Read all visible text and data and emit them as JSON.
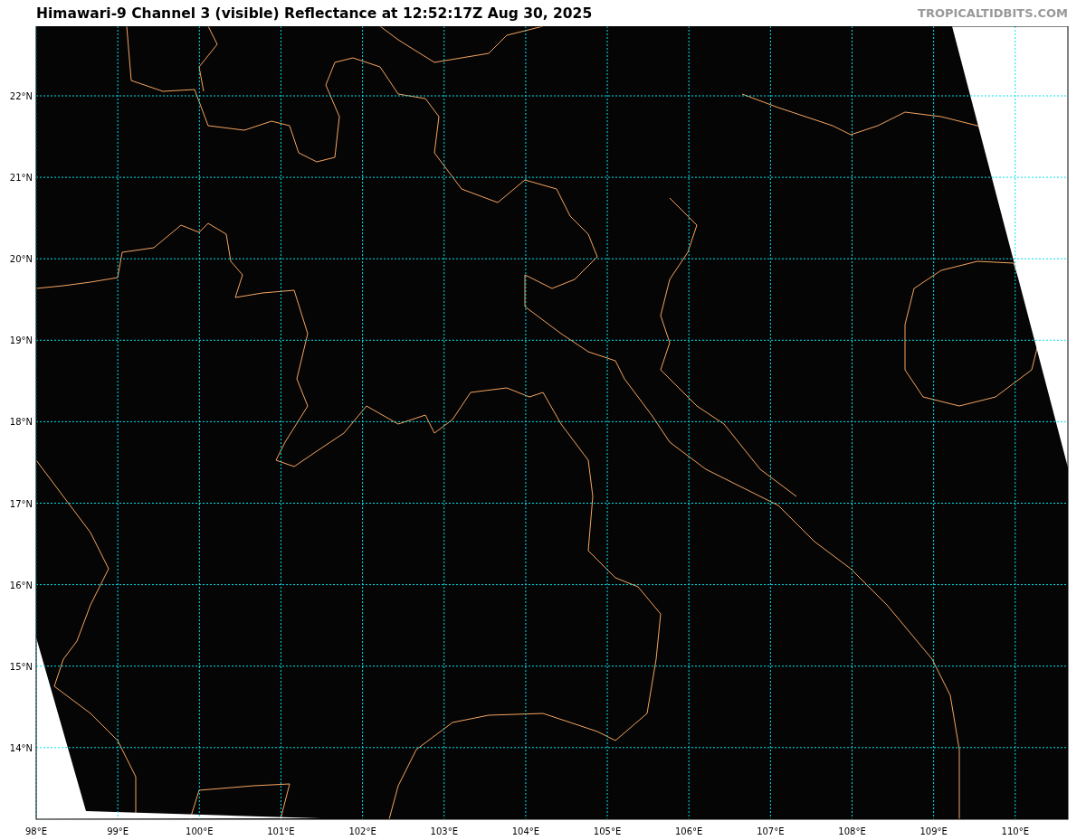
{
  "title": "Himawari-9 Channel 3 (visible) Reflectance at 12:52:17Z Aug 30, 2025",
  "credit": "TROPICALTIDBITS.COM",
  "map": {
    "y_ticks": [
      "22°N",
      "21°N",
      "20°N",
      "19°N",
      "18°N",
      "17°N",
      "16°N",
      "15°N",
      "14°N"
    ],
    "x_ticks": [
      "98°E",
      "99°E",
      "100°E",
      "101°E",
      "102°E",
      "103°E",
      "104°E",
      "105°E",
      "106°E",
      "107°E",
      "108°E",
      "109°E",
      "110°E"
    ]
  }
}
